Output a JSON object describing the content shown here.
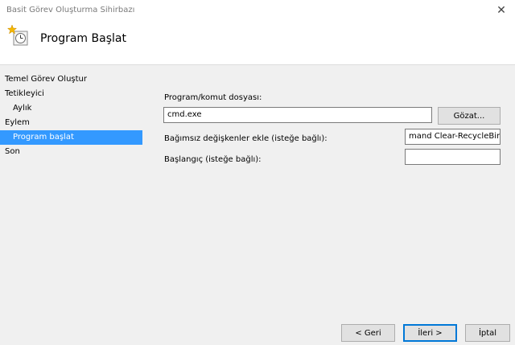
{
  "window": {
    "title": "Basit Görev Oluşturma Sihirbazı",
    "close_glyph": "✕"
  },
  "header": {
    "title": "Program Başlat",
    "icon": "task-clock-icon"
  },
  "sidebar": {
    "items": [
      {
        "label": "Temel Görev Oluştur",
        "level": 0,
        "selected": false
      },
      {
        "label": "Tetikleyici",
        "level": 0,
        "selected": false
      },
      {
        "label": "Aylık",
        "level": 1,
        "selected": false
      },
      {
        "label": "Eylem",
        "level": 0,
        "selected": false
      },
      {
        "label": "Program başlat",
        "level": 1,
        "selected": true
      },
      {
        "label": "Son",
        "level": 0,
        "selected": false
      }
    ]
  },
  "form": {
    "program_label": "Program/komut dosyası:",
    "program_value": "cmd.exe",
    "browse_label": "Gözat...",
    "args_label": "Bağımsız değişkenler ekle (isteğe bağlı):",
    "args_value": "mand Clear-RecycleBin\"",
    "start_label": "Başlangıç (isteğe bağlı):",
    "start_value": ""
  },
  "buttons": {
    "back": "< Geri",
    "next": "İleri >",
    "cancel": "İptal"
  },
  "colors": {
    "selection": "#3399ff",
    "accent": "#0078d7"
  }
}
